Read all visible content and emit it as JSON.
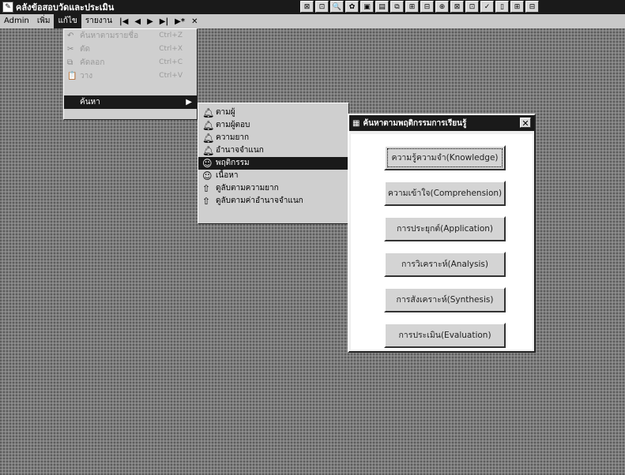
{
  "titlebar": {
    "title": "คลังข้อสอบวัดและประเมิน"
  },
  "toolbar": {
    "buttons": [
      "⊠",
      "⊡",
      "🔍",
      "✿",
      "▣",
      "▤",
      "⧉",
      "⊞",
      "⊟",
      "⊕",
      "⊠",
      "⊡",
      "✓",
      "▯",
      "⊞",
      "⊟"
    ]
  },
  "menubar": {
    "items": [
      "Admin",
      "เพิ่ม",
      "แก้ไข",
      "รายงาน"
    ],
    "nav": [
      "|◀",
      "◀",
      "▶",
      "▶|",
      "▶*",
      "✕"
    ]
  },
  "dropdown": {
    "items": [
      {
        "label": "ค้นหาตามรายชื่อ",
        "shortcut": "Ctrl+Z"
      },
      {
        "label": "ตัด",
        "shortcut": "Ctrl+X"
      },
      {
        "label": "คัดลอก",
        "shortcut": "Ctrl+C"
      },
      {
        "label": "วาง",
        "shortcut": "Ctrl+V"
      }
    ],
    "selected": "ค้นหา"
  },
  "submenu": {
    "items": [
      {
        "label": "ตามผู้",
        "icon": "bell-icon"
      },
      {
        "label": "ตามผู้ตอบ",
        "icon": "bell-icon"
      },
      {
        "label": "ความยาก",
        "icon": "bell-icon"
      },
      {
        "label": "อำนาจจำแนก",
        "icon": "bell-icon"
      },
      {
        "label": "พฤติกรรม",
        "icon": "smiley-icon"
      },
      {
        "label": "เนื้อหา",
        "icon": "smiley-icon"
      },
      {
        "label": "ดูลับตามความยาก",
        "icon": "thumb-icon"
      },
      {
        "label": "ดูลับตามค่าอำนาจจำแนก",
        "icon": "thumb-icon"
      }
    ],
    "selected_index": 4
  },
  "dialog": {
    "title": "ค้นหาตามพฤติกรรมการเรียนรู้",
    "buttons": [
      "ความรู้ความจำ(Knowledge)",
      "ความเข้าใจ(Comprehension)",
      "การประยุกต์(Application)",
      "การวิเคราะห์(Analysis)",
      "การสังเคราะห์(Synthesis)",
      "การประเมิน(Evaluation)"
    ]
  }
}
